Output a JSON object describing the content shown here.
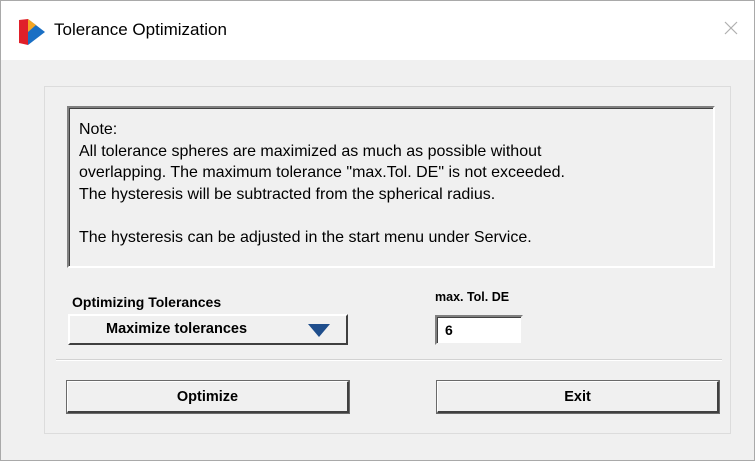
{
  "window": {
    "title": "Tolerance Optimization"
  },
  "icons": {
    "app": "app-logo-icon",
    "close": "close-icon",
    "dropdown": "triangle-down-icon"
  },
  "note": {
    "lines": [
      "Note:",
      "All tolerance spheres are maximized as much as possible without",
      "overlapping. The maximum tolerance \"max.Tol. DE\" is not exceeded.",
      "The hysteresis will be subtracted from the  spherical radius.",
      "",
      "The hysteresis can be adjusted in the start menu under Service."
    ]
  },
  "optimizing": {
    "label": "Optimizing Tolerances",
    "selected": "Maximize tolerances"
  },
  "max_tol": {
    "label": "max. Tol. DE",
    "value": "6"
  },
  "buttons": {
    "optimize": "Optimize",
    "exit": "Exit"
  },
  "colors": {
    "logo_red": "#e0202a",
    "logo_orange": "#f5a623",
    "logo_blue": "#1a6fc4",
    "dropdown_arrow": "#1f4e8c"
  }
}
